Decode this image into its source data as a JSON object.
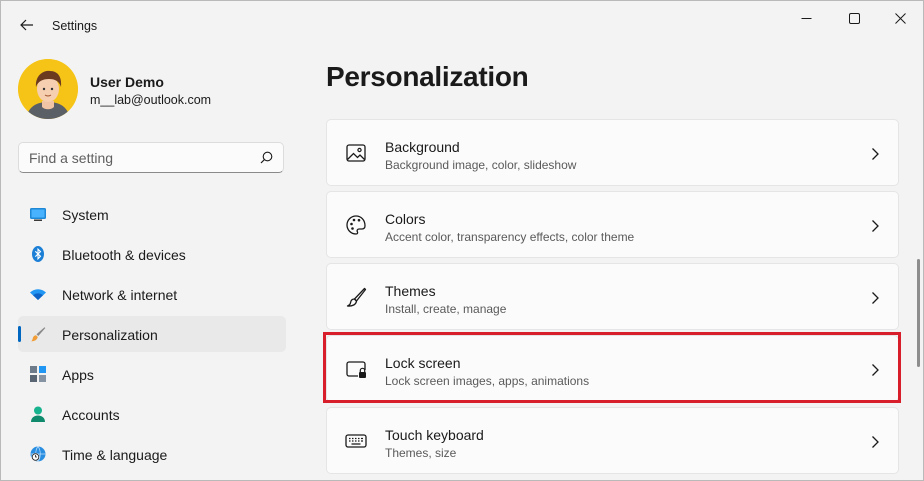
{
  "app": {
    "title": "Settings"
  },
  "user": {
    "name": "User Demo",
    "email": "m__lab@outlook.com"
  },
  "search": {
    "placeholder": "Find a setting"
  },
  "nav": {
    "items": [
      {
        "label": "System",
        "icon": "monitor-icon"
      },
      {
        "label": "Bluetooth & devices",
        "icon": "bluetooth-icon"
      },
      {
        "label": "Network & internet",
        "icon": "wifi-icon"
      },
      {
        "label": "Personalization",
        "icon": "paintbrush-icon",
        "active": true
      },
      {
        "label": "Apps",
        "icon": "apps-icon"
      },
      {
        "label": "Accounts",
        "icon": "person-icon"
      },
      {
        "label": "Time & language",
        "icon": "globe-clock-icon"
      }
    ]
  },
  "main": {
    "title": "Personalization",
    "cards": [
      {
        "title": "Background",
        "subtitle": "Background image, color, slideshow",
        "icon": "picture-icon"
      },
      {
        "title": "Colors",
        "subtitle": "Accent color, transparency effects, color theme",
        "icon": "palette-icon"
      },
      {
        "title": "Themes",
        "subtitle": "Install, create, manage",
        "icon": "brush-icon"
      },
      {
        "title": "Lock screen",
        "subtitle": "Lock screen images, apps, animations",
        "icon": "lock-screen-icon",
        "highlighted": true
      },
      {
        "title": "Touch keyboard",
        "subtitle": "Themes, size",
        "icon": "keyboard-icon"
      }
    ]
  },
  "colors": {
    "accent": "#0067c0",
    "highlight_border": "#d81e2a",
    "background": "#f3f3f3",
    "card": "#fbfbfb"
  }
}
